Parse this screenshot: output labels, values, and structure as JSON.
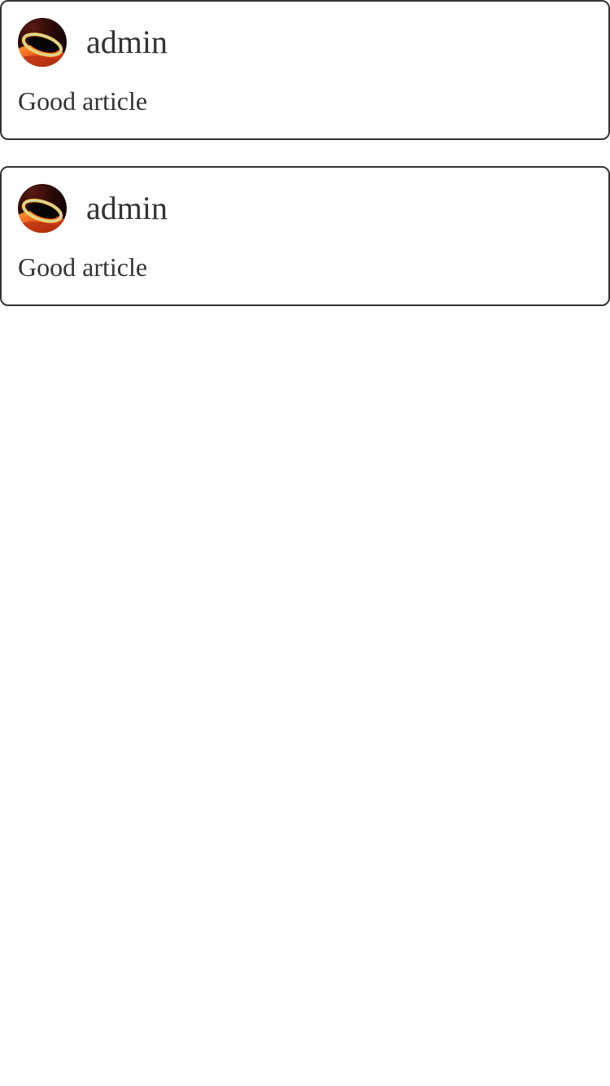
{
  "comments": [
    {
      "username": "admin",
      "text": "Good article",
      "avatar_icon": "black-hole-avatar"
    },
    {
      "username": "admin",
      "text": "Good article",
      "avatar_icon": "black-hole-avatar"
    }
  ],
  "colors": {
    "text": "#333333",
    "card_border": "#333333",
    "background": "#ffffff"
  }
}
